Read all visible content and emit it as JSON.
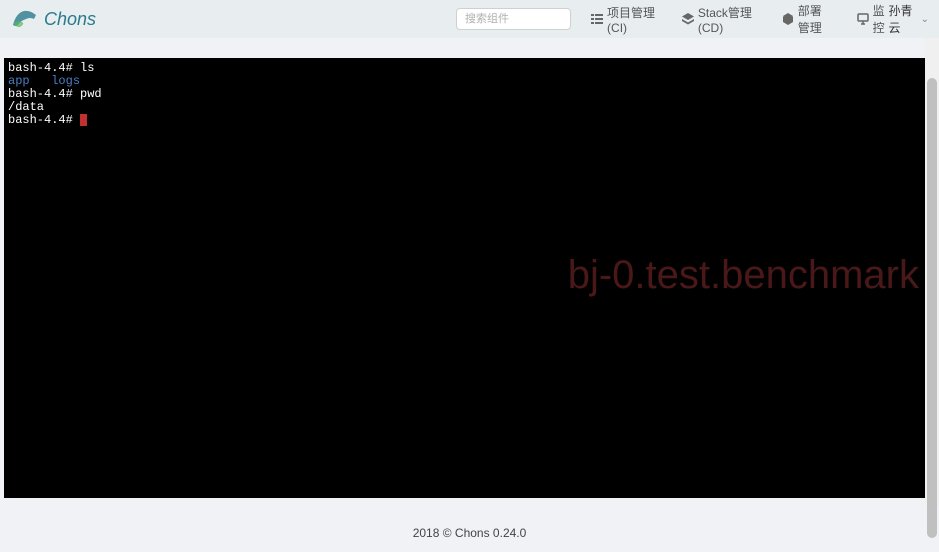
{
  "header": {
    "logo_text": "Chons",
    "search_placeholder": "搜索组件",
    "nav": [
      {
        "icon": "list-icon",
        "label": "项目管理(CI)"
      },
      {
        "icon": "stack-icon",
        "label": "Stack管理(CD)"
      },
      {
        "icon": "cube-icon",
        "label": "部署管理"
      },
      {
        "icon": "monitor-icon",
        "label": "监控"
      }
    ],
    "user_name": "孙青云"
  },
  "terminal": {
    "lines": [
      {
        "prompt": "bash-4.4# ",
        "cmd": "ls",
        "type": "cmd"
      },
      {
        "text_blue1": "app",
        "text_blue2": "logs",
        "type": "output-blue"
      },
      {
        "prompt": "bash-4.4# ",
        "cmd": "pwd",
        "type": "cmd"
      },
      {
        "text": "/data",
        "type": "output"
      },
      {
        "prompt": "bash-4.4# ",
        "type": "prompt-cursor"
      }
    ],
    "watermark": "bj-0.test.benchmark"
  },
  "footer": {
    "text": "2018 © Chons 0.24.0"
  }
}
